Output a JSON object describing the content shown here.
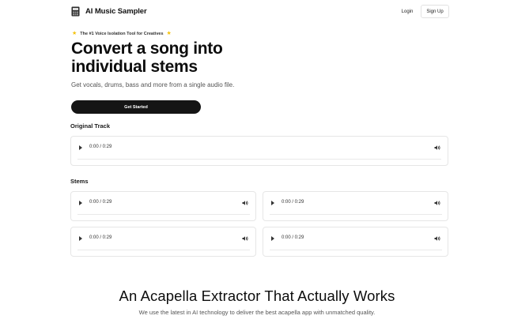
{
  "app": {
    "title": "AI Music Sampler"
  },
  "nav": {
    "login": "Login",
    "signup": "Sign Up"
  },
  "hero": {
    "tagline": "The #1 Voice Isolation Tool for Creatives",
    "headline": "Convert a song into individual stems",
    "subheadline": "Get vocals, drums, bass and more from a single audio file.",
    "cta": "Get Started"
  },
  "original": {
    "title": "Original Track",
    "player": {
      "time": "0:00 / 0:29"
    }
  },
  "stems": {
    "title": "Stems",
    "players": [
      {
        "time": "0:00 / 0:29"
      },
      {
        "time": "0:00 / 0:29"
      },
      {
        "time": "0:00 / 0:29"
      },
      {
        "time": "0:00 / 0:29"
      }
    ]
  },
  "feature": {
    "title": "An Acapella Extractor That Actually Works",
    "subtitle": "We use the latest in AI technology to deliver the best acapella app with unmatched quality."
  },
  "icons": {
    "logo": "sampler-device-icon",
    "star": "star-icon",
    "play": "play-icon",
    "volume": "volume-icon"
  },
  "colors": {
    "star": "#f4c20d",
    "primary_button": "#151515"
  }
}
